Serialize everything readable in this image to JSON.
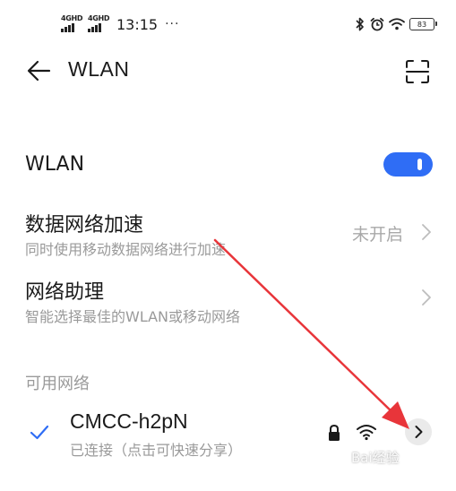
{
  "status_bar": {
    "net1_label": "4GHD",
    "net2_label": "4GHD",
    "time": "13:15",
    "more": "···",
    "battery": "83"
  },
  "header": {
    "title": "WLAN",
    "back_icon": "arrow-left-icon",
    "scan_icon": "scan-icon"
  },
  "wlan_toggle": {
    "label": "WLAN",
    "enabled": true
  },
  "data_acceleration": {
    "title": "数据网络加速",
    "subtitle": "同时使用移动数据网络进行加速",
    "value": "未开启"
  },
  "network_assistant": {
    "title": "网络助理",
    "subtitle": "智能选择最佳的WLAN或移动网络"
  },
  "available_networks": {
    "section_label": "可用网络",
    "networks": [
      {
        "ssid": "CMCC-h2pN",
        "status": "已连接（点击可快速分享）",
        "connected": true,
        "secured": true
      }
    ]
  },
  "watermark": "Bai经验",
  "colors": {
    "accent": "#2f6df5",
    "annotation_arrow": "#e8353a",
    "secondary_text": "#9a9a9a"
  }
}
